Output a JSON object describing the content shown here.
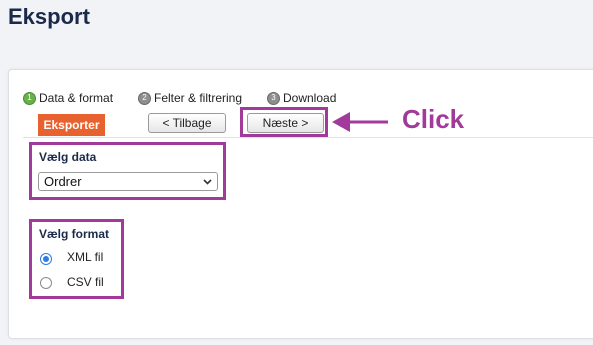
{
  "page": {
    "title": "Eksport"
  },
  "steps": [
    {
      "number": "1",
      "label": "Data & format"
    },
    {
      "number": "2",
      "label": "Felter & filtrering"
    },
    {
      "number": "3",
      "label": "Download"
    }
  ],
  "tabs": {
    "active": "Eksporter"
  },
  "buttons": {
    "back": "< Tilbage",
    "next": "Næste >"
  },
  "annotation": {
    "text": "Click",
    "color": "#a23a9c"
  },
  "data_section": {
    "label": "Vælg data",
    "selected": "Ordrer"
  },
  "format_section": {
    "label": "Vælg format",
    "options": [
      {
        "label": "XML fil",
        "checked": true
      },
      {
        "label": "CSV fil",
        "checked": false
      }
    ]
  },
  "colors": {
    "accent_tab": "#e8622f",
    "radio_selected": "#2f7be0",
    "title": "#1b2a4a"
  }
}
